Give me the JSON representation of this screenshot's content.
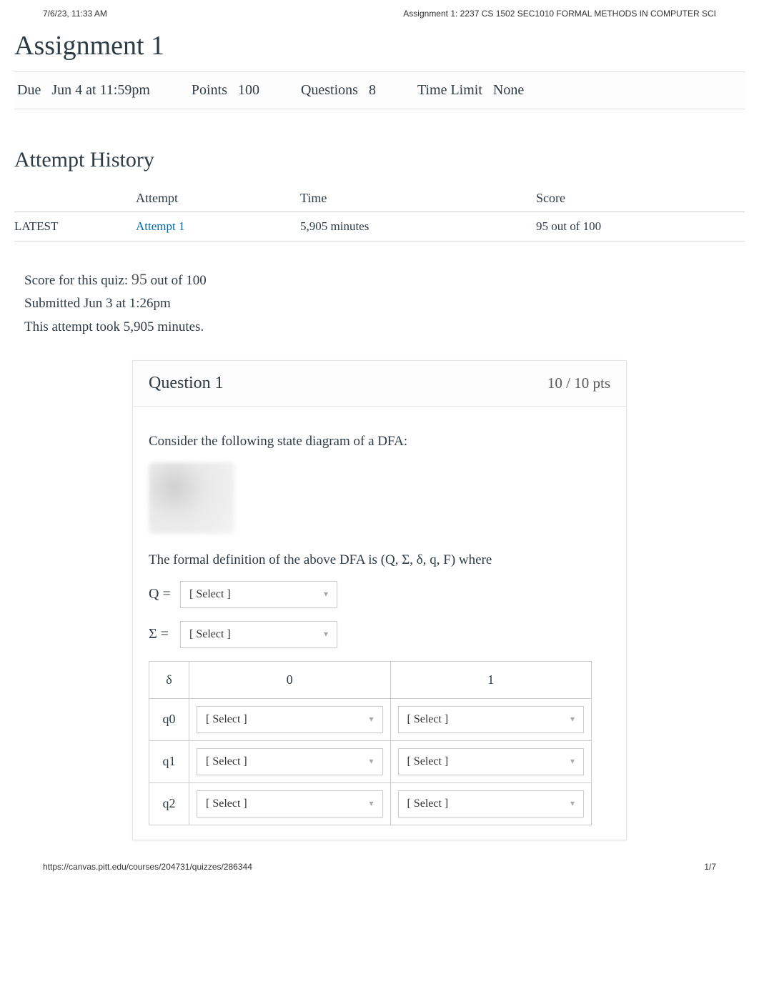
{
  "print_header": {
    "left": "7/6/23, 11:33 AM",
    "right": "Assignment 1: 2237 CS 1502 SEC1010 FORMAL METHODS IN COMPUTER SCI"
  },
  "title": "Assignment 1",
  "meta": {
    "due_label": "Due",
    "due_value": "Jun 4 at 11:59pm",
    "points_label": "Points",
    "points_value": "100",
    "questions_label": "Questions",
    "questions_value": "8",
    "time_limit_label": "Time Limit",
    "time_limit_value": "None"
  },
  "attempt_history": {
    "heading": "Attempt History",
    "columns": {
      "attempt": "Attempt",
      "time": "Time",
      "score": "Score"
    },
    "rows": [
      {
        "tag": "LATEST",
        "attempt": "Attempt 1",
        "time": "5,905 minutes",
        "score": "95 out of 100"
      }
    ]
  },
  "score_block": {
    "label": "Score for this quiz:",
    "score": "95",
    "suffix": "out of 100",
    "submitted": "Submitted Jun 3 at 1:26pm",
    "duration": "This attempt took 5,905 minutes."
  },
  "question": {
    "title": "Question 1",
    "points": "10 / 10 pts",
    "intro": "Consider the following state diagram of a DFA:",
    "formal_def": "The formal definition of the above DFA is (Q, Σ, δ, q, F) where",
    "select_placeholder": "[ Select ]",
    "Q_label": "Q =",
    "Sigma_label": "Σ =",
    "delta": {
      "header": {
        "sym": "δ",
        "c0": "0",
        "c1": "1"
      },
      "rows": [
        {
          "state": "q0"
        },
        {
          "state": "q1"
        },
        {
          "state": "q2"
        }
      ]
    }
  },
  "print_footer": {
    "left": "https://canvas.pitt.edu/courses/204731/quizzes/286344",
    "right": "1/7"
  }
}
